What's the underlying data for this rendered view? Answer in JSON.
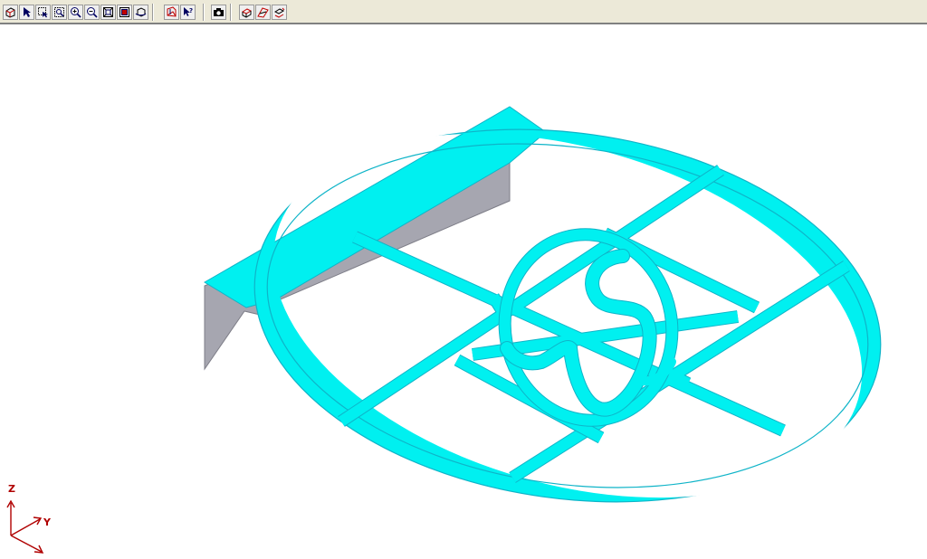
{
  "toolbar": {
    "buttons": [
      {
        "name": "isometric-view-icon"
      },
      {
        "name": "select-pointer-icon"
      },
      {
        "name": "select-window-icon"
      },
      {
        "name": "zoom-window-icon"
      },
      {
        "name": "zoom-in-icon"
      },
      {
        "name": "zoom-out-icon"
      },
      {
        "name": "zoom-fit-icon"
      },
      {
        "name": "zoom-previous-icon"
      },
      {
        "name": "rotate-view-icon"
      },
      {
        "name": "shade-mode-icon"
      },
      {
        "name": "help-pointer-icon"
      },
      {
        "name": "snapshot-camera-icon"
      },
      {
        "name": "section-view-icon"
      },
      {
        "name": "section-plane-icon"
      },
      {
        "name": "section-off-icon"
      }
    ]
  },
  "viewport": {
    "background": "#ffffff",
    "model_top_color": "#00f0f0",
    "model_side_color": "#a6a6b0",
    "model_edge_color": "#0fb4c8"
  },
  "triad": {
    "x_label": "",
    "y_label": "Y",
    "z_label": "Z",
    "color": "#b00000"
  }
}
